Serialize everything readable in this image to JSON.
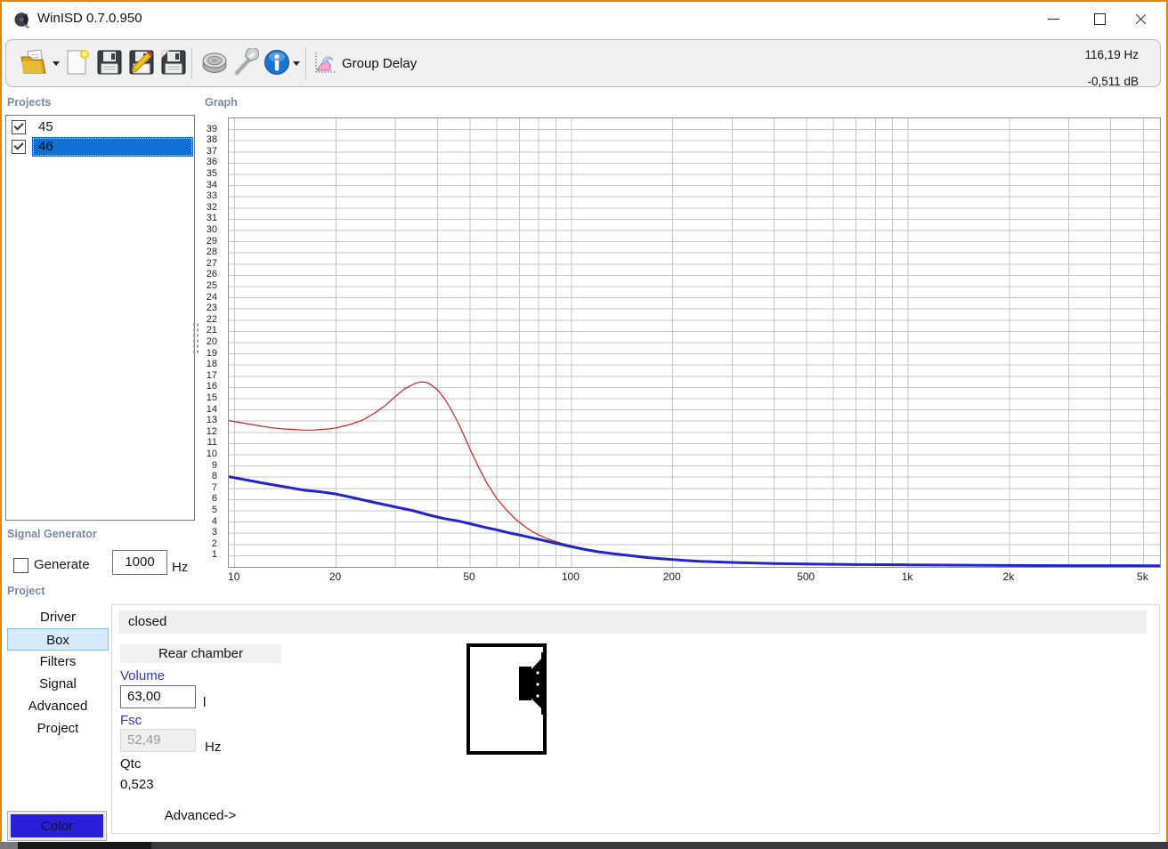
{
  "window": {
    "title": "WinISD 0.7.0.950"
  },
  "toolbar": {
    "icons": [
      "open-project",
      "new-project",
      "save",
      "edit",
      "save-as",
      "driver-database",
      "options-wrench",
      "about-info",
      "group-delay-chart"
    ],
    "group_delay_label": "Group Delay",
    "readout_frequency": "116,19 Hz",
    "readout_level": "-0,511 dB"
  },
  "projects_panel": {
    "label": "Projects",
    "items": [
      {
        "name": "45",
        "checked": true,
        "selected": false
      },
      {
        "name": "46",
        "checked": true,
        "selected": true
      }
    ]
  },
  "graph_panel": {
    "label": "Graph"
  },
  "signal_generator": {
    "label": "Signal Generator",
    "checkbox_label": "Generate",
    "checkbox_checked": false,
    "frequency_value": "1000",
    "unit": "Hz"
  },
  "project_section": {
    "label": "Project",
    "tabs": [
      {
        "label": "Driver",
        "selected": false
      },
      {
        "label": "Box",
        "selected": true
      },
      {
        "label": "Filters",
        "selected": false
      },
      {
        "label": "Signal",
        "selected": false
      },
      {
        "label": "Advanced",
        "selected": false
      },
      {
        "label": "Project",
        "selected": false
      }
    ]
  },
  "box_tab": {
    "type_header": "closed",
    "rear_chamber_button": "Rear chamber",
    "volume_label": "Volume",
    "volume_value": "63,00",
    "volume_unit": "l",
    "fsc_label": "Fsc",
    "fsc_value": "52,49",
    "fsc_unit": "Hz",
    "qtc_label": "Qtc",
    "qtc_value": "0,523",
    "advanced_button": "Advanced->",
    "color_button_label": "Color",
    "color_button_color": "#2a1fd9"
  },
  "chart_data": {
    "type": "line",
    "title": "Group Delay",
    "x_scale": "log",
    "xlim": [
      9.6,
      5600
    ],
    "ylim": [
      0,
      40
    ],
    "grid": true,
    "x_ticks": [
      {
        "f": 10,
        "label": "10"
      },
      {
        "f": 20,
        "label": "20"
      },
      {
        "f": 50,
        "label": "50"
      },
      {
        "f": 100,
        "label": "100"
      },
      {
        "f": 200,
        "label": "200"
      },
      {
        "f": 500,
        "label": "500"
      },
      {
        "f": 1000,
        "label": "1k"
      },
      {
        "f": 2000,
        "label": "2k"
      },
      {
        "f": 5000,
        "label": "5k"
      }
    ],
    "y_ticks": [
      1,
      2,
      3,
      4,
      5,
      6,
      7,
      8,
      9,
      10,
      11,
      12,
      13,
      14,
      15,
      16,
      17,
      18,
      19,
      20,
      21,
      22,
      23,
      24,
      25,
      26,
      27,
      28,
      29,
      30,
      31,
      32,
      33,
      34,
      35,
      36,
      37,
      38,
      39
    ],
    "series": [
      {
        "name": "45",
        "color": "#cc2222",
        "width": 1.2,
        "points": [
          [
            9.6,
            13.05
          ],
          [
            11,
            12.75
          ],
          [
            12,
            12.55
          ],
          [
            13,
            12.4
          ],
          [
            14,
            12.3
          ],
          [
            15,
            12.25
          ],
          [
            16,
            12.2
          ],
          [
            17,
            12.2
          ],
          [
            18,
            12.25
          ],
          [
            19,
            12.3
          ],
          [
            20,
            12.4
          ],
          [
            22,
            12.7
          ],
          [
            24,
            13.1
          ],
          [
            26,
            13.7
          ],
          [
            28,
            14.4
          ],
          [
            30,
            15.2
          ],
          [
            32,
            15.9
          ],
          [
            34,
            16.3
          ],
          [
            35,
            16.45
          ],
          [
            36,
            16.5
          ],
          [
            37,
            16.45
          ],
          [
            38,
            16.3
          ],
          [
            40,
            15.8
          ],
          [
            42,
            15.0
          ],
          [
            44,
            14.0
          ],
          [
            46,
            12.9
          ],
          [
            48,
            11.7
          ],
          [
            50,
            10.5
          ],
          [
            53,
            8.9
          ],
          [
            56,
            7.5
          ],
          [
            60,
            6.1
          ],
          [
            64,
            5.1
          ],
          [
            68,
            4.3
          ],
          [
            72,
            3.7
          ],
          [
            76,
            3.2
          ],
          [
            80,
            2.85
          ],
          [
            85,
            2.5
          ],
          [
            90,
            2.25
          ],
          [
            95,
            2.05
          ],
          [
            100,
            1.9
          ],
          [
            110,
            1.6
          ],
          [
            120,
            1.4
          ],
          [
            135,
            1.15
          ],
          [
            150,
            1.0
          ],
          [
            170,
            0.85
          ],
          [
            200,
            0.68
          ],
          [
            240,
            0.55
          ],
          [
            300,
            0.42
          ],
          [
            400,
            0.3
          ],
          [
            500,
            0.25
          ],
          [
            700,
            0.18
          ],
          [
            1000,
            0.13
          ],
          [
            1500,
            0.1
          ],
          [
            2000,
            0.08
          ],
          [
            3000,
            0.06
          ],
          [
            5600,
            0.05
          ]
        ]
      },
      {
        "name": "46",
        "color": "#2323cc",
        "width": 3,
        "points": [
          [
            9.6,
            8.05
          ],
          [
            12,
            7.5
          ],
          [
            14,
            7.15
          ],
          [
            16,
            6.85
          ],
          [
            18,
            6.7
          ],
          [
            20,
            6.5
          ],
          [
            23,
            6.1
          ],
          [
            26,
            5.75
          ],
          [
            30,
            5.35
          ],
          [
            34,
            5.0
          ],
          [
            38,
            4.6
          ],
          [
            42,
            4.3
          ],
          [
            46,
            4.1
          ],
          [
            50,
            3.85
          ],
          [
            55,
            3.55
          ],
          [
            60,
            3.3
          ],
          [
            65,
            3.05
          ],
          [
            70,
            2.85
          ],
          [
            80,
            2.45
          ],
          [
            90,
            2.1
          ],
          [
            100,
            1.8
          ],
          [
            110,
            1.55
          ],
          [
            120,
            1.35
          ],
          [
            135,
            1.15
          ],
          [
            150,
            1.0
          ],
          [
            170,
            0.82
          ],
          [
            200,
            0.65
          ],
          [
            240,
            0.5
          ],
          [
            300,
            0.4
          ],
          [
            400,
            0.3
          ],
          [
            500,
            0.26
          ],
          [
            700,
            0.21
          ],
          [
            1000,
            0.18
          ],
          [
            1500,
            0.15
          ],
          [
            2000,
            0.13
          ],
          [
            3000,
            0.11
          ],
          [
            5600,
            0.1
          ]
        ]
      }
    ]
  }
}
